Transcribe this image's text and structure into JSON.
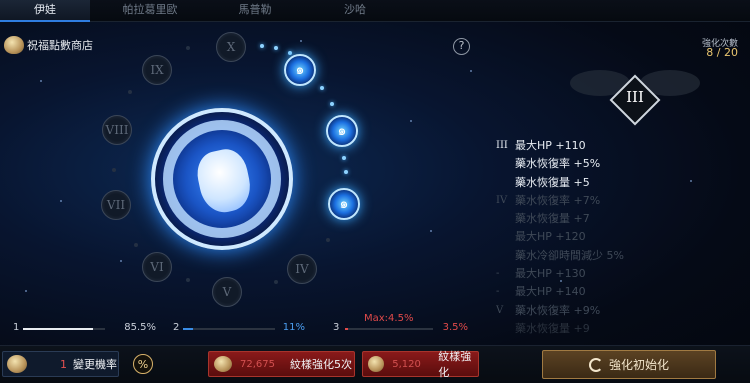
{
  "tabs": [
    {
      "label": "伊娃",
      "active": true
    },
    {
      "label": "帕拉葛里歐",
      "active": false
    },
    {
      "label": "馬普勒",
      "active": false
    },
    {
      "label": "沙哈",
      "active": false
    }
  ],
  "shop": {
    "label": "祝福點數商店",
    "icon": "blessing-bag-icon"
  },
  "help": {
    "label": "?"
  },
  "wheel": {
    "nodes": [
      "X",
      "IX",
      "VIII",
      "VII",
      "VI",
      "V",
      "IV"
    ],
    "lit_nodes": [
      "swirl-icon",
      "swirl-icon",
      "swirl-icon"
    ],
    "emblem_icon": "aquarius-emblem-icon"
  },
  "enhance": {
    "label": "強化次數",
    "value": "8 / 20",
    "crest_numeral": "III"
  },
  "stats": [
    {
      "tier": "III",
      "text": "最大HP +110",
      "style": "b"
    },
    {
      "tier": "",
      "text": "藥水恢復率 +5%",
      "style": "b"
    },
    {
      "tier": "",
      "text": "藥水恢復量 +5",
      "style": "b"
    },
    {
      "tier": "IV",
      "text": "藥水恢復率 +7%",
      "style": "d"
    },
    {
      "tier": "",
      "text": "藥水恢復量 +7",
      "style": "d"
    },
    {
      "tier": "",
      "text": "最大HP +120",
      "style": "d"
    },
    {
      "tier": "",
      "text": "藥水冷卻時間減少 5%",
      "style": "d"
    },
    {
      "tier": "-",
      "text": "最大HP +130",
      "style": "d"
    },
    {
      "tier": "-",
      "text": "最大HP +140",
      "style": "d"
    },
    {
      "tier": "V",
      "text": "藥水恢復率 +9%",
      "style": "d"
    },
    {
      "tier": "",
      "text": "藥水恢復量 +9",
      "style": "f"
    }
  ],
  "probabilities": [
    {
      "index": "1",
      "value": "85.5%",
      "fraction": 0.855,
      "color": "#e8ecf0",
      "text_color": "#c9cfd8"
    },
    {
      "index": "2",
      "value": "11%",
      "fraction": 0.11,
      "color": "#3a8de6",
      "text_color": "#4b9ef0"
    },
    {
      "index": "3",
      "value": "3.5%",
      "fraction": 0.035,
      "color": "#e04a4a",
      "text_color": "#e04a4a"
    }
  ],
  "max_label": "Max:4.5%",
  "buttons": {
    "change_rate": {
      "count": "1",
      "label": "變更機率"
    },
    "percent": {
      "label": "%"
    },
    "enhance_five": {
      "cost": "72,675",
      "label": "紋樣強化5次"
    },
    "enhance_one": {
      "cost": "5,120",
      "label": "紋樣強化"
    },
    "reset": {
      "label": "強化初始化",
      "icon": "reset-icon"
    }
  },
  "colors": {
    "accent_blue": "#2f7de0",
    "gold": "#e9c56f",
    "red": "#e04a4a"
  }
}
